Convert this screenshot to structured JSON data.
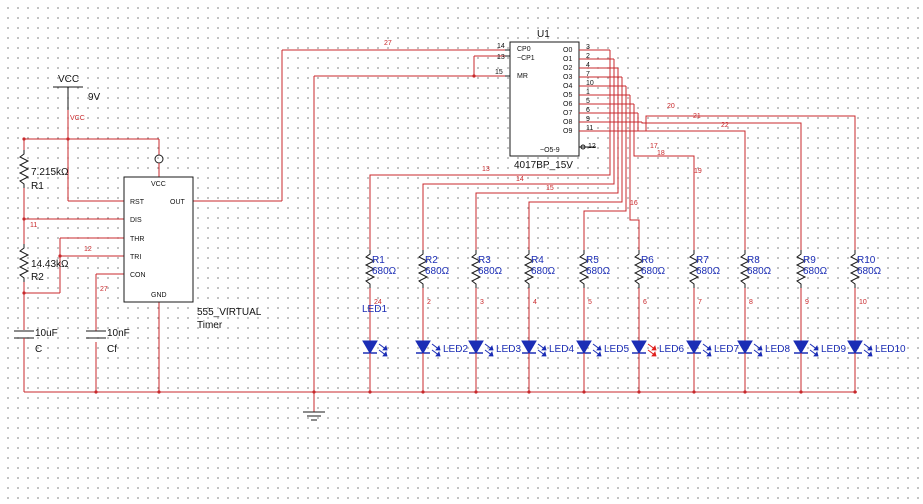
{
  "power": {
    "vcc_label": "VCC",
    "voltage_label": "9V",
    "vcc_net_label": "VCC"
  },
  "timer": {
    "pins": [
      "RST",
      "DIS",
      "THR",
      "TRI",
      "CON"
    ],
    "vcc_label": "VCC",
    "out_label": "OUT",
    "gnd_label": "GND",
    "name": "555_VIRTUAL",
    "subname": "Timer"
  },
  "resistors_timing": [
    {
      "value": "7.215kΩ",
      "ref": "R1"
    },
    {
      "value": "14.43kΩ",
      "ref": "R2"
    }
  ],
  "capacitors": [
    {
      "value": "10uF",
      "ref": "C"
    },
    {
      "value": "10nF",
      "ref": "Cf"
    }
  ],
  "counter": {
    "ref": "U1",
    "part": "4017BP_15V",
    "left_pins": [
      {
        "num": "14",
        "name": "CP0"
      },
      {
        "num": "13",
        "name": "~CP1"
      },
      {
        "num": "15",
        "name": "MR"
      }
    ],
    "outputs": [
      {
        "name": "O0",
        "num": "3"
      },
      {
        "name": "O1",
        "num": "2"
      },
      {
        "name": "O2",
        "num": "4"
      },
      {
        "name": "O3",
        "num": "7"
      },
      {
        "name": "O4",
        "num": "10"
      },
      {
        "name": "O5",
        "num": "1"
      },
      {
        "name": "O6",
        "num": "5"
      },
      {
        "name": "O7",
        "num": "6"
      },
      {
        "name": "O8",
        "num": "9"
      },
      {
        "name": "O9",
        "num": "11"
      }
    ],
    "carry_pin": {
      "name": "~O5-9",
      "num": "12"
    }
  },
  "nets": {
    "clock": "27",
    "n11": "11",
    "n12": "12",
    "con": "27",
    "top": [
      "13",
      "14",
      "15",
      "16",
      "17",
      "18",
      "19",
      "20",
      "21",
      "22"
    ],
    "led_cathode": [
      "24",
      "2",
      "3",
      "4",
      "5",
      "6",
      "7",
      "8",
      "9",
      "10"
    ]
  },
  "led_resistors": [
    {
      "ref": "R1",
      "value": "680Ω"
    },
    {
      "ref": "R2",
      "value": "680Ω"
    },
    {
      "ref": "R3",
      "value": "680Ω"
    },
    {
      "ref": "R4",
      "value": "680Ω"
    },
    {
      "ref": "R5",
      "value": "680Ω"
    },
    {
      "ref": "R6",
      "value": "680Ω"
    },
    {
      "ref": "R7",
      "value": "680Ω"
    },
    {
      "ref": "R8",
      "value": "680Ω"
    },
    {
      "ref": "R9",
      "value": "680Ω"
    },
    {
      "ref": "R10",
      "value": "680Ω"
    }
  ],
  "leds": [
    {
      "ref": "LED1",
      "lit": false
    },
    {
      "ref": "LED2",
      "lit": false
    },
    {
      "ref": "LED3",
      "lit": false
    },
    {
      "ref": "LED4",
      "lit": false
    },
    {
      "ref": "LED5",
      "lit": false
    },
    {
      "ref": "LED6",
      "lit": true
    },
    {
      "ref": "LED7",
      "lit": false
    },
    {
      "ref": "LED8",
      "lit": false
    },
    {
      "ref": "LED9",
      "lit": false
    },
    {
      "ref": "LED10",
      "lit": false
    }
  ],
  "colors": {
    "wire": "#c8292c",
    "component": "#1a1a1a",
    "led": "#1b2db5",
    "led_lit": "#e0201c"
  }
}
